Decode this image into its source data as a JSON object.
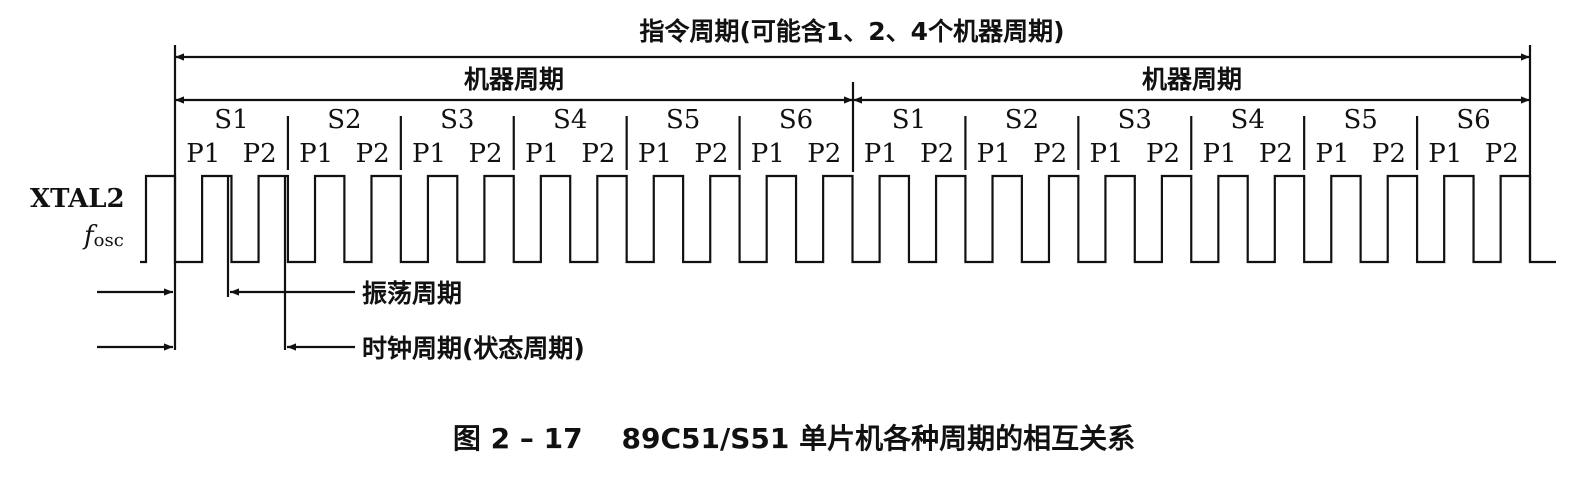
{
  "instruction_cycle": {
    "label": "指令周期(可能含1、2、4个机器周期)"
  },
  "machine_cycles": [
    {
      "label": "机器周期"
    },
    {
      "label": "机器周期"
    }
  ],
  "states": [
    "S1",
    "S2",
    "S3",
    "S4",
    "S5",
    "S6"
  ],
  "phases": [
    "P1",
    "P2"
  ],
  "signal": {
    "name": "XTAL2",
    "f": "f",
    "sub": "osc"
  },
  "annotations": {
    "oscillation_period": "振荡周期",
    "clock_period": "时钟周期(状态周期)"
  },
  "caption": "图 2 – 17    89C51/S51 单片机各种周期的相互关系"
}
